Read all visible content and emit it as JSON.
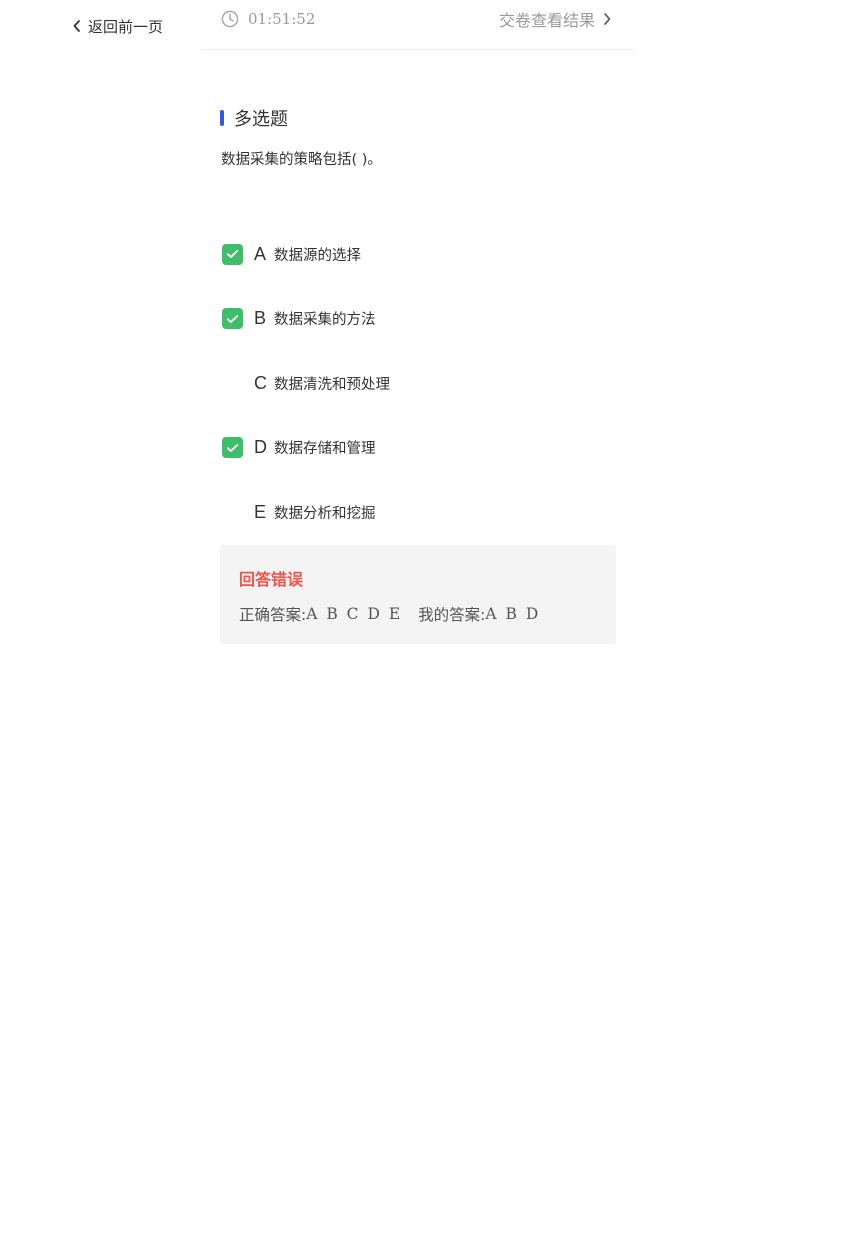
{
  "nav": {
    "back_label": "返回前一页"
  },
  "header": {
    "timer": "01:51:52",
    "submit_label": "交卷查看结果"
  },
  "question": {
    "type_label": "多选题",
    "text": "数据采集的策略包括(  )。"
  },
  "options": [
    {
      "letter": "A",
      "text": "数据源的选择",
      "checked": true
    },
    {
      "letter": "B",
      "text": "数据采集的方法",
      "checked": true
    },
    {
      "letter": "C",
      "text": "数据清洗和预处理",
      "checked": false
    },
    {
      "letter": "D",
      "text": "数据存储和管理",
      "checked": true
    },
    {
      "letter": "E",
      "text": "数据分析和挖掘",
      "checked": false
    }
  ],
  "result": {
    "status": "回答错误",
    "correct_label": "正确答案:",
    "correct_value": "A B C D E",
    "mine_label": "我的答案:",
    "mine_value": "A B D"
  },
  "colors": {
    "accent_bar": "#2f5be7",
    "check_green": "#3fbe6a",
    "error_red": "#f0554a",
    "muted_gray": "#9a9a9a"
  }
}
